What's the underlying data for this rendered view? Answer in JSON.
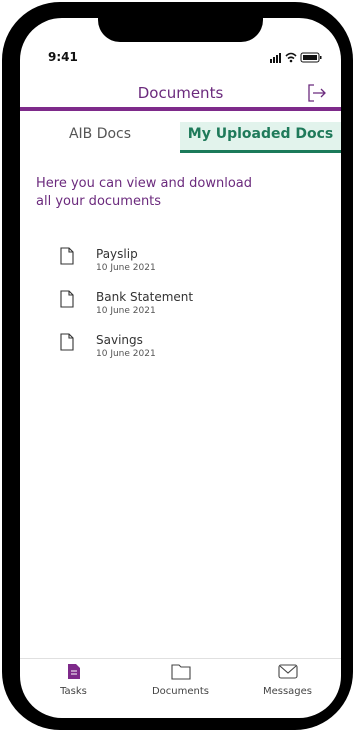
{
  "status": {
    "time": "9:41"
  },
  "header": {
    "title": "Documents"
  },
  "tabs": [
    {
      "label": "AIB Docs"
    },
    {
      "label": "My Uploaded Docs"
    }
  ],
  "intro": "Here you can view and download all your documents",
  "documents": [
    {
      "name": "Payslip",
      "date": "10 June 2021"
    },
    {
      "name": "Bank Statement",
      "date": "10 June 2021"
    },
    {
      "name": "Savings",
      "date": "10 June 2021"
    }
  ],
  "nav": [
    {
      "label": "Tasks"
    },
    {
      "label": "Documents"
    },
    {
      "label": "Messages"
    }
  ]
}
